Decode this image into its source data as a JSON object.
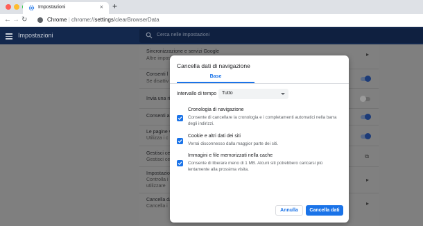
{
  "browser": {
    "tab": {
      "title": "Impostazioni",
      "close": "×"
    },
    "new_tab": "+",
    "nav": {
      "back": "←",
      "forward": "→",
      "reload": "↻"
    },
    "address": {
      "origin": "Chrome",
      "separator": "|",
      "scheme": "chrome://",
      "host": "settings",
      "path": "/clearBrowserData"
    },
    "colors": {
      "close": "#ff5f57",
      "minimize": "#febc2e",
      "zoom": "#28c840"
    }
  },
  "settings": {
    "title": "Impostazioni",
    "search_placeholder": "Cerca nelle impostazioni",
    "rows": [
      {
        "title": "Sincronizzazione e servizi Google",
        "sub": "Altre impost"
      },
      {
        "title": "Consenti l",
        "sub": "Se disattiv"
      },
      {
        "title": "Invia una ri",
        "sub": ""
      },
      {
        "title": "Consenti al",
        "sub": ""
      },
      {
        "title": "Le pagine v",
        "sub": "Utilizza i c"
      },
      {
        "title": "Gestisci ce",
        "sub": "Gestisci ce"
      },
      {
        "title": "Impostazio",
        "sub": "Controlla i",
        "sub2": "utilizzare"
      },
      {
        "title": "Cancella da",
        "sub": "Cancella i"
      }
    ]
  },
  "dialog": {
    "title": "Cancella dati di navigazione",
    "tab_basic": "Base",
    "time_range_label": "Intervallo di tempo",
    "time_range_value": "Tutto",
    "options": [
      {
        "title": "Cronologia di navigazione",
        "desc": "Consente di cancellare la cronologia e i completamenti automatici nella barra degli indirizzi.",
        "checked": true
      },
      {
        "title": "Cookie e altri dati dei siti",
        "desc": "Verrai disconnesso dalla maggior parte dei siti.",
        "checked": true
      },
      {
        "title": "Immagini e file memorizzati nella cache",
        "desc": "Consente di liberare meno di 1 MB. Alcuni siti potrebbero caricarsi più lentamente alla prossima visita.",
        "checked": true
      }
    ],
    "cancel_label": "Annulla",
    "clear_label": "Cancella dati"
  },
  "colors": {
    "accent": "#1a73e8",
    "header": "#13284d"
  }
}
